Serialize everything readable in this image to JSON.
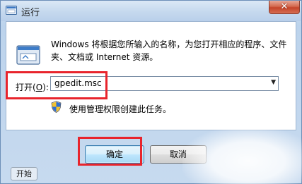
{
  "window": {
    "title": "运行",
    "close_glyph": "✕"
  },
  "description": "Windows 将根据您所输入的名称，为您打开相应的程序、文件夹、文档或 Internet 资源。",
  "open_field": {
    "label_prefix": "打开(",
    "label_key": "O",
    "label_suffix": "):",
    "value": "gpedit.msc"
  },
  "admin_note": "使用管理权限创建此任务。",
  "buttons": {
    "ok": "确定",
    "cancel": "取消"
  },
  "taskbar": {
    "start_label": "开始"
  },
  "colors": {
    "highlight": "#e8242c",
    "title_bg": "#c5d9ee",
    "close_red": "#c4442a"
  }
}
